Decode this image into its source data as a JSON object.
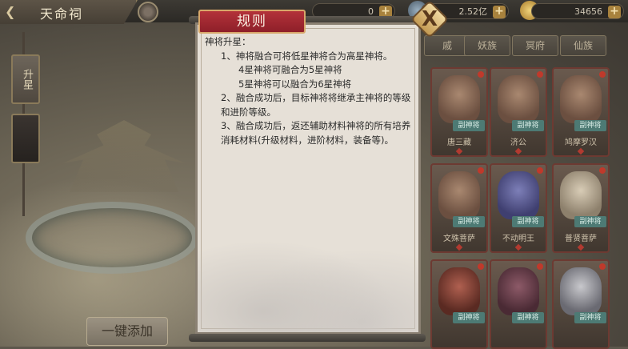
{
  "header": {
    "title": "天命祠",
    "resources": [
      {
        "icon": "blank-resource-icon",
        "value": "0"
      },
      {
        "icon": "coin-icon",
        "value": "2.52亿"
      },
      {
        "icon": "gold-ingot-icon",
        "value": "34656"
      }
    ],
    "plus_label": "+"
  },
  "side_nav": {
    "items": [
      {
        "label": "升星"
      },
      {
        "label": ""
      }
    ]
  },
  "actions": {
    "one_click_add": "一键添加"
  },
  "tabs": [
    {
      "label": "戚"
    },
    {
      "label": "妖族"
    },
    {
      "label": "冥府"
    },
    {
      "label": "仙族"
    }
  ],
  "cards": [
    {
      "name": "唐三藏",
      "badge": "副神将"
    },
    {
      "name": "济公",
      "badge": "副神将"
    },
    {
      "name": "鸠摩罗汉",
      "badge": "副神将"
    },
    {
      "name": "文殊菩萨",
      "badge": "副神将"
    },
    {
      "name": "不动明王",
      "badge": "副神将"
    },
    {
      "name": "普贤菩萨",
      "badge": "副神将"
    },
    {
      "name": "",
      "badge": "副神将"
    },
    {
      "name": "",
      "badge": "副神将"
    },
    {
      "name": "",
      "badge": "副神将"
    }
  ],
  "modal": {
    "title": "规则",
    "close_label": "X",
    "lines": [
      "神将升星：",
      "1、神将融合可将低星神将合为高星神将。",
      "4星神将可融合为5星神将",
      "5星神将可以融合为6星神将",
      "2、融合成功后，目标神将将继承主神将的等级和进阶等级。",
      "3、融合成功后，返还辅助材料神将的所有培养消耗材料(升级材料，进阶材料，装备等)。"
    ]
  },
  "colors": {
    "title_red": "#a52832",
    "modal_paper": "#e6e0d7",
    "plus_gold": "#a8823d"
  }
}
